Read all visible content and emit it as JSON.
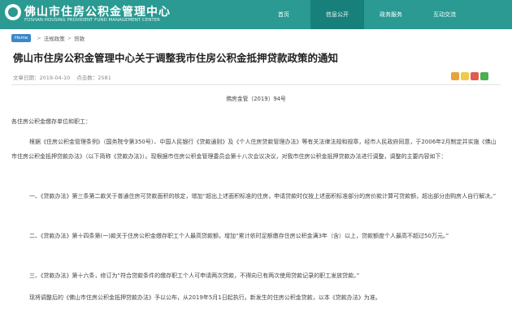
{
  "header": {
    "site_title": "佛山市住房公积金管理中心",
    "site_subtitle": "FOSHAN HOUSING PROVIDENT FUND MANAGEMENT CENTER",
    "nav": [
      {
        "label": "首页"
      },
      {
        "label": "信息公开"
      },
      {
        "label": "政务服务"
      },
      {
        "label": "互动交流"
      }
    ]
  },
  "breadcrumb": {
    "home": "Home",
    "items": [
      "法规政策",
      "贷款"
    ],
    "separator": ">"
  },
  "article": {
    "title": "佛山市住房公积金管理中心关于调整我市住房公积金抵押贷款政策的通知",
    "date_label": "文章日期：2019-04-10",
    "hits_label": "点击数：2581",
    "doc_number": "佛房金管〔2019〕94号",
    "paragraphs": [
      "各住房公积金缴存单位和职工：",
      "根据《住房公积金管理条例》（国务院令第350号）、中国人民银行《贷款通则》及《个人住房贷款管理办法》等有关法律法规和规章，经市人民政府同意，于2006年2月制定并实施《佛山市住房公积金抵押贷款办法》（以下简称《贷款办法》）。现根据市住房公积金管理委员会第十八次会议决议，对我市住房公积金抵押贷款办法进行调整，调整的主要内容如下：",
      "一、《贷款办法》第三条第二款关于普通住房可贷款面积的核定，增加“超出上述面积标准的住房，申请贷款时仅按上述面积标准部分的房价款计算可贷款额，超出部分由购房人自行解决。”",
      "二、《贷款办法》第十四条第(一)款关于住房公积金缴存职工个人最高贷款额，增加“累计依时足额缴存住房公积金满3年（含）以上，贷款额度个人最高不超过50万元。”",
      "三、《贷款办法》第十六条，修订为“符合贷款条件的缴存职工个人可申请两次贷款，不得向已有两次使用贷款记录的职工发放贷款。”",
      "现将调整后的《佛山市住房公积金抵押贷款办法》予以公布，从2019年5月1日起执行。新发生的住房公积金贷款，以本《贷款办法》为准。"
    ]
  },
  "colors": {
    "header_bg": "#2a9a92",
    "nav_active_bg": "#18807a",
    "home_badge": "#3b88c8"
  },
  "share_icons": [
    "share-plus-icon",
    "qzone-icon",
    "weibo-icon",
    "wechat-icon"
  ]
}
